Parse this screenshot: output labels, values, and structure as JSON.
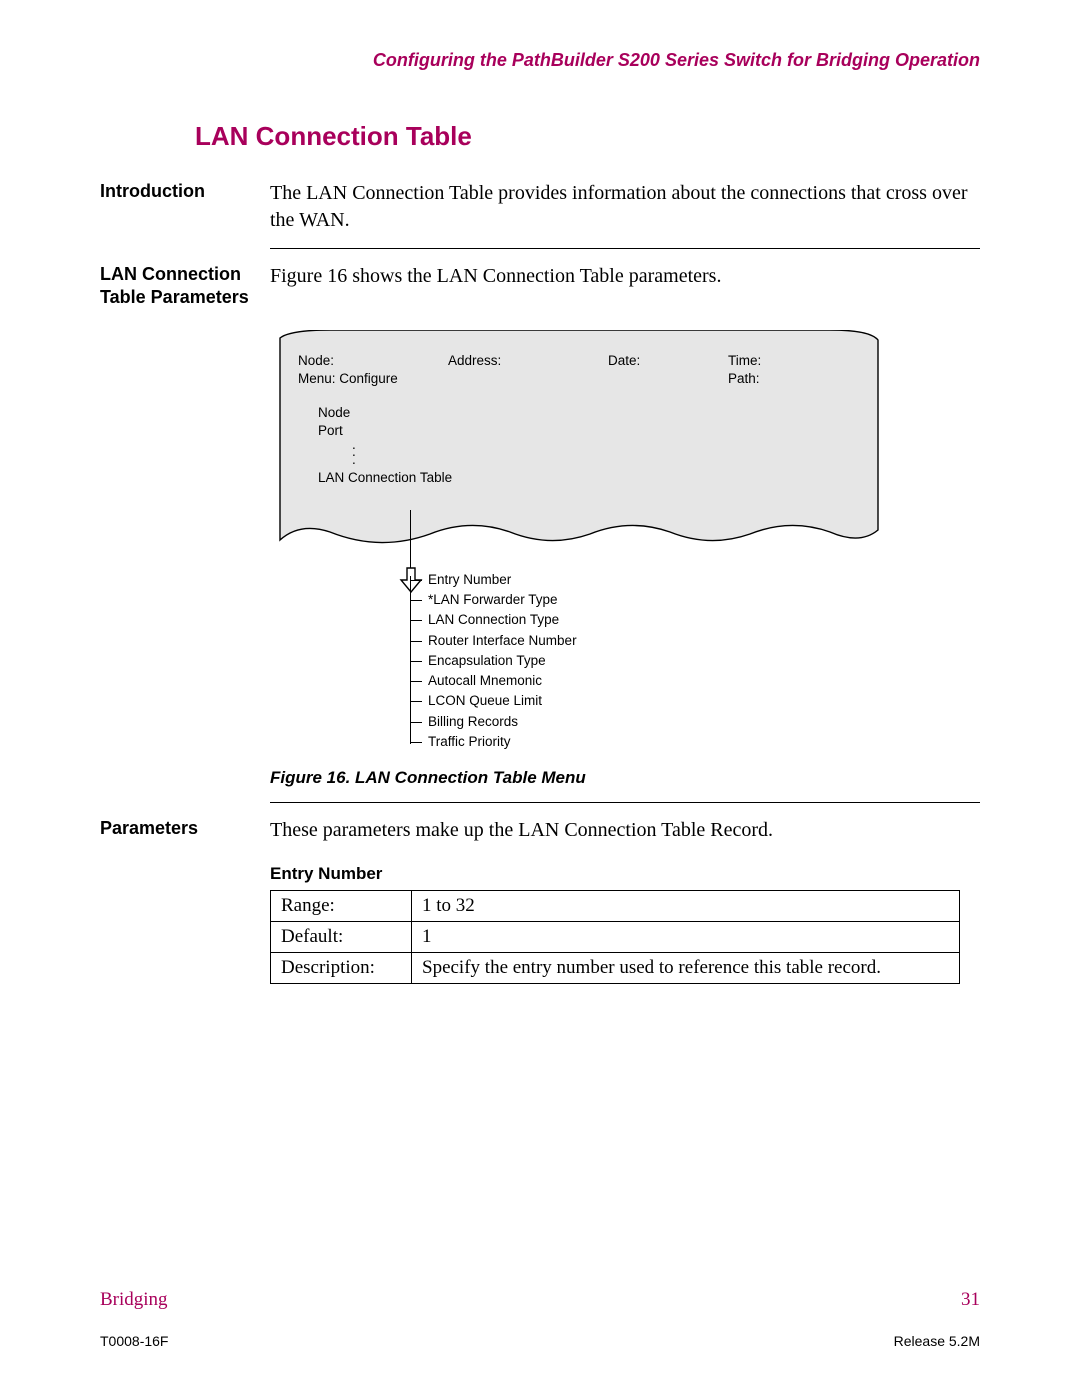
{
  "runningHead": "Configuring the PathBuilder S200 Series Switch for Bridging Operation",
  "sectionTitle": "LAN Connection Table",
  "intro": {
    "label": "Introduction",
    "text": "The LAN Connection Table provides information about the connections that cross over the WAN."
  },
  "params": {
    "label": "LAN Connection Table Parameters",
    "text": "Figure 16 shows the LAN Connection Table parameters."
  },
  "diagram": {
    "header": {
      "node": "Node:",
      "address": "Address:",
      "date": "Date:",
      "time": "Time:",
      "menu": "Menu: Configure",
      "path": "Path:"
    },
    "tree": {
      "node": "Node",
      "port": "Port",
      "lct": "LAN Connection Table"
    },
    "subitems": [
      "Entry Number",
      "*LAN Forwarder Type",
      "LAN Connection Type",
      "Router Interface Number",
      "Encapsulation Type",
      "Autocall Mnemonic",
      "LCON Queue Limit",
      "Billing Records",
      "Traffic Priority"
    ],
    "caption": "Figure 16. LAN Connection Table Menu"
  },
  "paramsBlock": {
    "label": "Parameters",
    "text": "These parameters make up the LAN Connection Table Record.",
    "entry": {
      "title": "Entry Number",
      "rows": {
        "rangeK": "Range:",
        "rangeV": "1 to 32",
        "defaultK": "Default:",
        "defaultV": "1",
        "descK": "Description:",
        "descV": "Specify the entry number used to reference this table record."
      }
    }
  },
  "footer": {
    "section": "Bridging",
    "page": "31",
    "docId": "T0008-16F",
    "release": "Release 5.2M"
  }
}
